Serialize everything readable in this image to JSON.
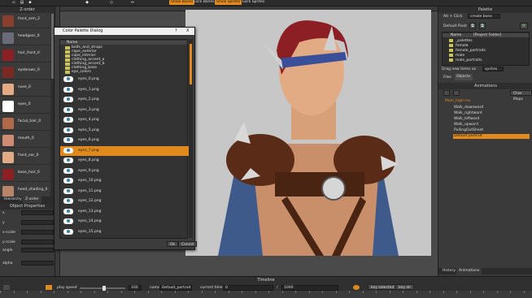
{
  "toolbar": {
    "btn_show_bones": "Show Bones",
    "btn_lock_bones": "Lock Bones",
    "btn_show_sprites": "Show Sprites",
    "btn_lock_sprites": "Lock Sprites"
  },
  "zorder": {
    "title": "Z-order",
    "items": [
      "front_arm_2",
      "headgear_0",
      "hair_front_0",
      "eyebrows_0",
      "nose_0",
      "eyes_0",
      "facial_hair_0",
      "mouth_0",
      "front_ear_0",
      "base_hair_0",
      "head_shading_0"
    ],
    "tabs": [
      "Hierarchy",
      "Z-order"
    ]
  },
  "props": {
    "title": "Object Properties",
    "labels": [
      "x",
      "y",
      "x-scale",
      "y-scale",
      "angle",
      "alpha"
    ]
  },
  "dialog": {
    "title": "Color Palette Dialog",
    "help": "?",
    "close": "X",
    "col_header": "Name",
    "folders": [
      "belts_and_straps",
      "cape_exterior",
      "cape_interior",
      "clothing_accent_a",
      "clothing_accent_b",
      "clothing_base",
      "eye_colors"
    ],
    "items": [
      "eyes_0.png",
      "eyes_1.png",
      "eyes_2.png",
      "eyes_3.png",
      "eyes_4.png",
      "eyes_5.png",
      "eyes_6.png",
      "eyes_7.png",
      "eyes_8.png",
      "eyes_9.png",
      "eyes_10.png",
      "eyes_11.png",
      "eyes_12.png",
      "eyes_13.png",
      "eyes_14.png",
      "eyes_15.png"
    ],
    "selected_index": 7,
    "ok": "Ok",
    "cancel": "Cancel"
  },
  "palette": {
    "title": "Palette",
    "alt_click": "Alt + Click",
    "create_bone": "create bone",
    "default_pivot": "Default Pivot",
    "tree_header_name": "Name",
    "tree_header_project": "[Project Folder]",
    "tree_items": [
      "_palettes",
      "female",
      "female_portraits",
      "male",
      "male_portraits"
    ],
    "drag_hint": "Drag new items as",
    "drag_value": "sprites",
    "tabs": [
      "Files",
      "Objects"
    ]
  },
  "animations": {
    "title": "Animations",
    "change_maps": "Char Maps",
    "entity": "Male_high-res",
    "items": [
      "Walk_downward",
      "Walk_rightward",
      "Walk_leftward",
      "Walk_upward",
      "PullingOutSheet",
      "Default portrait"
    ],
    "selected_index": 5,
    "tabs": [
      "History",
      "Animations"
    ]
  },
  "timeline": {
    "title": "Timeline",
    "play_speed_label": "play speed",
    "play_speed_value": "100",
    "name_label": "name:",
    "name_value": "Default_portrait",
    "current_time_label": "current time:",
    "current_time_value": "0",
    "length_value": "1000",
    "key_selected": "key selected",
    "key_all": "key all"
  },
  "colors": {
    "accent": "#e08a1e",
    "stage": "#c7c7c7"
  }
}
